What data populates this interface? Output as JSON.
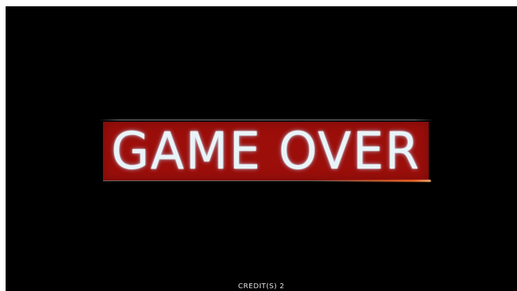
{
  "game": {
    "title": "GAME OVER",
    "credits": "CREDIT(S) 2"
  },
  "colors": {
    "background": "#000000",
    "banner": "#9c0e0a",
    "title_text": "#e8f4f8",
    "flare": "#ff6e28"
  }
}
